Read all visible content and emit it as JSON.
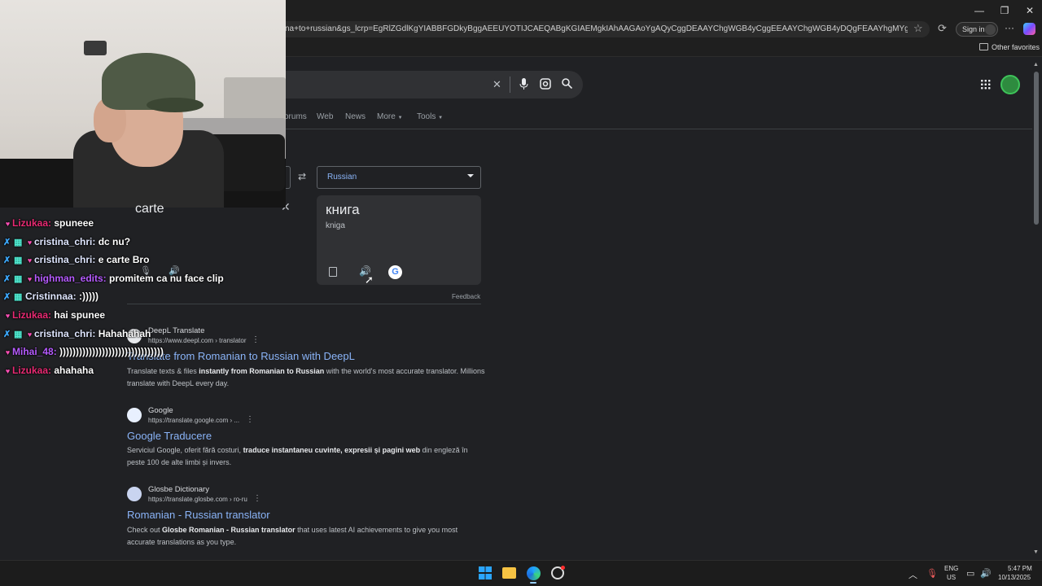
{
  "browser": {
    "address_text": "na+to+russian&gs_lcrp=EgRlZGdlKgYIABBFGDkyBggAEEUYOTIJCAEQABgKGIAEMgkIAhAAGAoYgAQyCggDEAAYChgWGB4yCggEEAAYChgWGB4yDQgFEAAYhgMYgAQYigUyDQgGEAAY...",
    "sign_in_label": "Sign in",
    "other_favorites": "Other favorites",
    "window_controls": {
      "minimize": "—",
      "restore": "❐",
      "close": "✕"
    }
  },
  "google": {
    "tabs": [
      "orums",
      "Web",
      "News",
      "More",
      "Tools"
    ],
    "source_text": "carte",
    "target_language": "Russian",
    "translation": "книга",
    "transliteration": "kniga",
    "feedback": "Feedback",
    "results": [
      {
        "site": "DeepL Translate",
        "url": "https://www.deepl.com › translator",
        "title": "Translate from Romanian to Russian with DeepL",
        "snippet_html": "Translate texts &amp; files <b>instantly from Romanian to Russian</b> with the world's most accurate translator. Millions translate with DeepL every day."
      },
      {
        "site": "Google",
        "url": "https://translate.google.com › ...",
        "title": "Google Traducere",
        "snippet_html": "Serviciul Google, oferit fără costuri, <b>traduce instantaneu cuvinte, expresii și pagini web</b> din engleză în peste 100 de alte limbi și invers."
      },
      {
        "site": "Glosbe Dictionary",
        "url": "https://translate.glosbe.com › ro-ru",
        "title": "Romanian - Russian translator",
        "snippet_html": "Check out <b>Glosbe Romanian - Russian translator</b> that uses latest AI achievements to give you most accurate translations as you type."
      }
    ]
  },
  "chat": [
    {
      "badges": [
        "heart"
      ],
      "user": "Lizukaa:",
      "user_color": "pink",
      "message": "spuneee"
    },
    {
      "badges": [
        "sword",
        "grid",
        "heart"
      ],
      "user": "cristina_chri:",
      "user_color": "light",
      "message": "dc nu?"
    },
    {
      "badges": [
        "sword",
        "grid",
        "heart"
      ],
      "user": "cristina_chri:",
      "user_color": "light",
      "message": "e carte Bro"
    },
    {
      "badges": [
        "sword",
        "grid",
        "heart"
      ],
      "user": "highman_edits:",
      "user_color": "purple",
      "message": "promitem ca nu face clip"
    },
    {
      "badges": [
        "sword",
        "grid"
      ],
      "user": "Cristinnaa:",
      "user_color": "light",
      "message": ":)))))"
    },
    {
      "badges": [
        "heart"
      ],
      "user": "Lizukaa:",
      "user_color": "pink",
      "message": "hai spunee"
    },
    {
      "badges": [
        "sword",
        "grid",
        "heart"
      ],
      "user": "cristina_chri:",
      "user_color": "light",
      "message": "Hahahahah"
    },
    {
      "badges": [
        "heart"
      ],
      "user": "Mihai_48:",
      "user_color": "purple",
      "message": "))))))))))))))))))))))))))))))))"
    },
    {
      "badges": [
        "heart"
      ],
      "user": "Lizukaa:",
      "user_color": "pink",
      "message": "ahahaha"
    }
  ],
  "taskbar": {
    "lang_top": "ENG",
    "lang_bottom": "US",
    "time": "5:47 PM",
    "date": "10/13/2025"
  },
  "colors": {
    "page_bg": "#202124",
    "link": "#8ab4f8",
    "chat_pink": "#e92a73",
    "chat_purple": "#b65bff"
  }
}
